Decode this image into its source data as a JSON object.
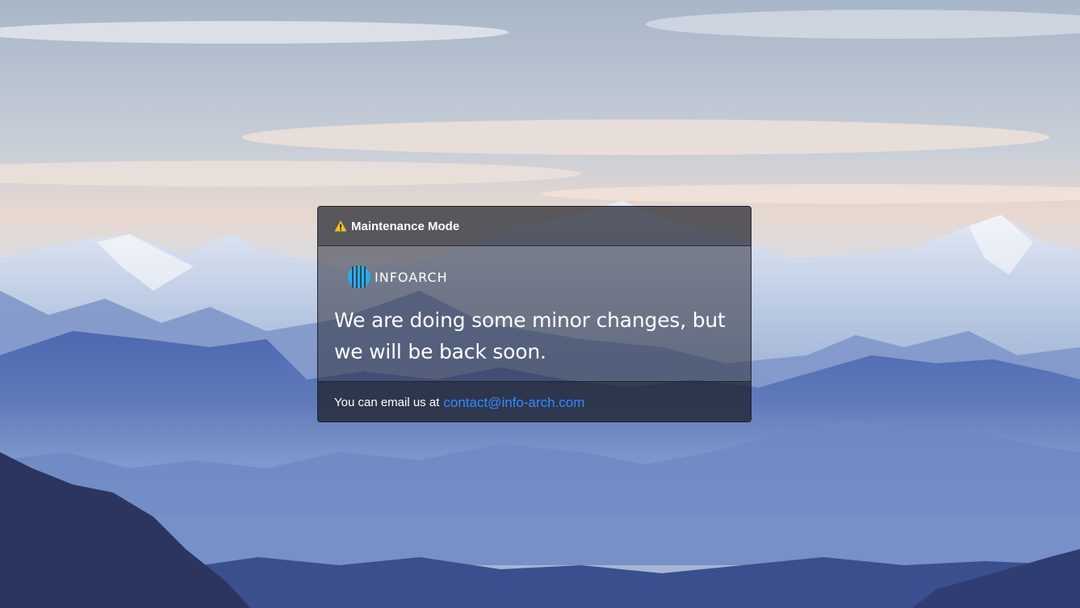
{
  "notice": {
    "title": "Maintenance Mode",
    "brand": "INFOARCH",
    "headline_line1": "We are doing some minor changes, but",
    "headline_line2": "we will be back soon.",
    "footer_text": "You can email us at",
    "email": "contact@info-arch.com"
  },
  "icons": {
    "header": "warning-icon",
    "brand": "infoarch-logo"
  },
  "colors": {
    "link": "#2f8cff",
    "warning": "#f2c318",
    "brand_accent": "#29aee6"
  }
}
